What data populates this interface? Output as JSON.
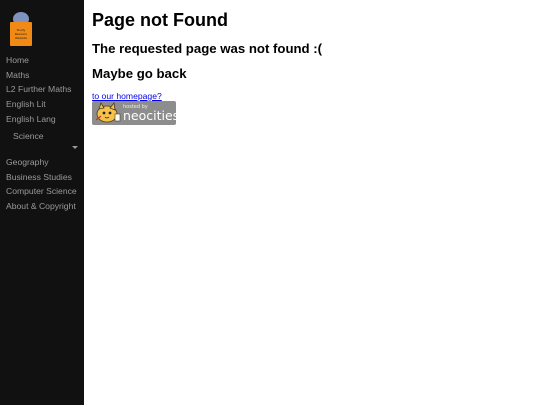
{
  "sidebar": {
    "logo_lines": [
      "Study",
      "Revision",
      "Website"
    ],
    "items": [
      {
        "label": "Home"
      },
      {
        "label": "Maths"
      },
      {
        "label": "L2 Further Maths"
      },
      {
        "label": "English Lit"
      },
      {
        "label": "English Lang"
      },
      {
        "label": "Science"
      },
      {
        "label": "Geography"
      },
      {
        "label": "Business Studies"
      },
      {
        "label": "Computer Science"
      },
      {
        "label": "About & Copyright"
      }
    ]
  },
  "main": {
    "title": "Page not Found",
    "subtitle": "The requested page was not found :(",
    "back_heading": "Maybe go back",
    "home_link": "to our homepage?",
    "badge": {
      "small_text": "hosted by",
      "big_text": "neocities"
    }
  },
  "colors": {
    "sidebar_bg": "#111111",
    "sidebar_text": "#9a9a9a",
    "logo_orange": "#f08a14",
    "logo_blue": "#7f93c0",
    "link": "#0000ee",
    "badge_bg": "#8d8d8d"
  }
}
